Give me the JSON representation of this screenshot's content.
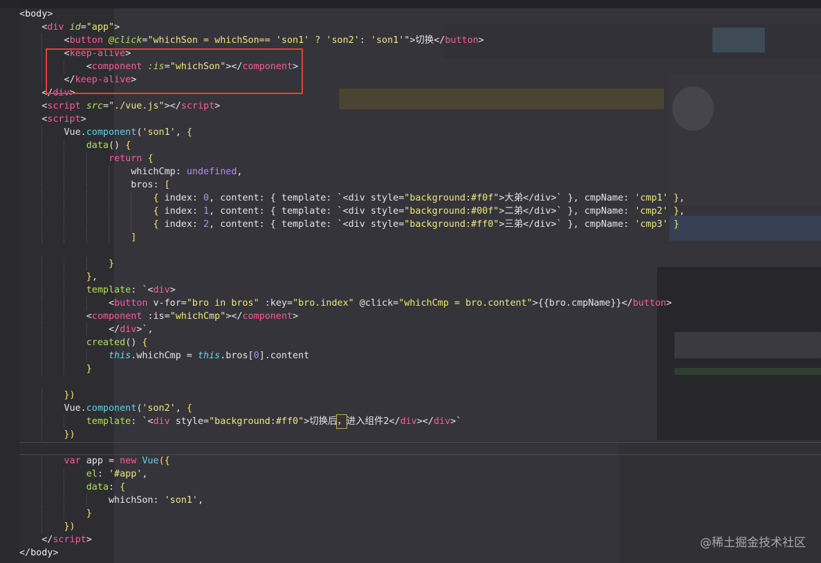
{
  "code_lines": [
    [
      [
        "t-punct",
        "<"
      ],
      [
        "t-tag",
        "body"
      ],
      [
        "t-punct",
        ">"
      ]
    ],
    [
      [
        "t-punct",
        "    <"
      ],
      [
        "t-name",
        "div"
      ],
      [
        "t-punct",
        " "
      ],
      [
        "t-attr-i",
        "id"
      ],
      [
        "t-punct",
        "="
      ],
      [
        "t-str",
        "\"app\""
      ],
      [
        "t-punct",
        ">"
      ]
    ],
    [
      [
        "t-punct",
        "        <"
      ],
      [
        "t-name",
        "button"
      ],
      [
        "t-punct",
        " "
      ],
      [
        "t-attr-i",
        "@click"
      ],
      [
        "t-punct",
        "="
      ],
      [
        "t-str",
        "\"whichSon = whichSon== 'son1' ? 'son2': 'son1'\""
      ],
      [
        "t-punct",
        ">切换</"
      ],
      [
        "t-name",
        "button"
      ],
      [
        "t-punct",
        ">"
      ]
    ],
    [
      [
        "t-punct",
        "        <"
      ],
      [
        "t-name",
        "keep-alive"
      ],
      [
        "t-punct",
        ">"
      ]
    ],
    [
      [
        "t-punct",
        "            <"
      ],
      [
        "t-name",
        "component"
      ],
      [
        "t-punct",
        " "
      ],
      [
        "t-attr-i",
        ":is"
      ],
      [
        "t-punct",
        "="
      ],
      [
        "t-str",
        "\"whichSon\""
      ],
      [
        "t-punct",
        "></"
      ],
      [
        "t-name",
        "component"
      ],
      [
        "t-punct",
        ">"
      ]
    ],
    [
      [
        "t-punct",
        "        </"
      ],
      [
        "t-name",
        "keep-alive"
      ],
      [
        "t-punct",
        ">"
      ]
    ],
    [
      [
        "t-punct",
        "    </"
      ],
      [
        "t-name",
        "div"
      ],
      [
        "t-punct",
        ">"
      ]
    ],
    [
      [
        "t-punct",
        "    <"
      ],
      [
        "t-name",
        "script"
      ],
      [
        "t-punct",
        " "
      ],
      [
        "t-attr-i",
        "src"
      ],
      [
        "t-punct",
        "="
      ],
      [
        "t-str",
        "\"./vue.js\""
      ],
      [
        "t-punct",
        "></"
      ],
      [
        "t-name",
        "script"
      ],
      [
        "t-punct",
        ">"
      ]
    ],
    [
      [
        "t-punct",
        "    <"
      ],
      [
        "t-name",
        "script"
      ],
      [
        "t-punct",
        ">"
      ]
    ],
    [
      [
        "t-punct",
        "        Vue."
      ],
      [
        "t-fn",
        "component"
      ],
      [
        "t-punct",
        "("
      ],
      [
        "t-str",
        "'son1'"
      ],
      [
        "t-punct",
        ", "
      ],
      [
        "t-brace",
        "{"
      ]
    ],
    [
      [
        "t-punct",
        "            "
      ],
      [
        "t-attr",
        "data"
      ],
      [
        "t-punct",
        "() "
      ],
      [
        "t-brace",
        "{"
      ]
    ],
    [
      [
        "t-punct",
        "                "
      ],
      [
        "t-kw",
        "return"
      ],
      [
        "t-punct",
        " "
      ],
      [
        "t-brace",
        "{"
      ]
    ],
    [
      [
        "t-punct",
        "                    whichCmp: "
      ],
      [
        "t-num",
        "undefined"
      ],
      [
        "t-punct",
        ","
      ]
    ],
    [
      [
        "t-punct",
        "                    bros: "
      ],
      [
        "t-brace",
        "["
      ]
    ],
    [
      [
        "t-punct",
        "                        "
      ],
      [
        "t-brace",
        "{"
      ],
      [
        "t-punct",
        " index: "
      ],
      [
        "t-num",
        "0"
      ],
      [
        "t-punct",
        ", content: { template: `<div style="
      ],
      [
        "t-str",
        "\"background:#f0f\""
      ],
      [
        "t-punct",
        ">大弟</div>` }, cmpName: "
      ],
      [
        "t-str",
        "'cmp1'"
      ],
      [
        "t-punct",
        " "
      ],
      [
        "t-brace",
        "}"
      ],
      [
        "t-punct",
        ","
      ]
    ],
    [
      [
        "t-punct",
        "                        "
      ],
      [
        "t-brace",
        "{"
      ],
      [
        "t-punct",
        " index: "
      ],
      [
        "t-num",
        "1"
      ],
      [
        "t-punct",
        ", content: { template: `<div style="
      ],
      [
        "t-str",
        "\"background:#00f\""
      ],
      [
        "t-punct",
        ">二弟</div>` }, cmpName: "
      ],
      [
        "t-str",
        "'cmp2'"
      ],
      [
        "t-punct",
        " "
      ],
      [
        "t-brace",
        "}"
      ],
      [
        "t-punct",
        ","
      ]
    ],
    [
      [
        "t-punct",
        "                        "
      ],
      [
        "t-brace",
        "{"
      ],
      [
        "t-punct",
        " index: "
      ],
      [
        "t-num",
        "2"
      ],
      [
        "t-punct",
        ", content: { template: `<div style="
      ],
      [
        "t-str",
        "\"background:#ff0\""
      ],
      [
        "t-punct",
        ">三弟</div>` }, cmpName: "
      ],
      [
        "t-str",
        "'cmp3'"
      ],
      [
        "t-punct",
        " "
      ],
      [
        "t-brace",
        "}"
      ]
    ],
    [
      [
        "t-punct",
        "                    "
      ],
      [
        "t-brace",
        "]"
      ]
    ],
    [
      [
        "t-punct",
        ""
      ]
    ],
    [
      [
        "t-punct",
        "                "
      ],
      [
        "t-brace",
        "}"
      ]
    ],
    [
      [
        "t-punct",
        "            "
      ],
      [
        "t-brace",
        "}"
      ],
      [
        "t-punct",
        ","
      ]
    ],
    [
      [
        "t-punct",
        "            "
      ],
      [
        "t-attr",
        "template"
      ],
      [
        "t-punct",
        ": `<"
      ],
      [
        "t-name",
        "div"
      ],
      [
        "t-punct",
        ">"
      ]
    ],
    [
      [
        "t-punct",
        "                <"
      ],
      [
        "t-name",
        "button"
      ],
      [
        "t-punct",
        " v-for="
      ],
      [
        "t-str",
        "\"bro in bros\""
      ],
      [
        "t-punct",
        " :key="
      ],
      [
        "t-str",
        "\"bro.index\""
      ],
      [
        "t-punct",
        " @click="
      ],
      [
        "t-str",
        "\"whichCmp = bro.content\""
      ],
      [
        "t-punct",
        ">{{bro.cmpName}}</"
      ],
      [
        "t-name",
        "button"
      ],
      [
        "t-punct",
        ">"
      ]
    ],
    [
      [
        "t-punct",
        "            <"
      ],
      [
        "t-name",
        "component"
      ],
      [
        "t-punct",
        " :is="
      ],
      [
        "t-str",
        "\"whichCmp\""
      ],
      [
        "t-punct",
        "></"
      ],
      [
        "t-name",
        "component"
      ],
      [
        "t-punct",
        ">"
      ]
    ],
    [
      [
        "t-punct",
        "                </"
      ],
      [
        "t-name",
        "div"
      ],
      [
        "t-punct",
        ">`,"
      ]
    ],
    [
      [
        "t-punct",
        "            "
      ],
      [
        "t-attr",
        "created"
      ],
      [
        "t-punct",
        "() "
      ],
      [
        "t-brace",
        "{"
      ]
    ],
    [
      [
        "t-punct",
        "                "
      ],
      [
        "t-this",
        "this"
      ],
      [
        "t-punct",
        ".whichCmp = "
      ],
      [
        "t-this",
        "this"
      ],
      [
        "t-punct",
        ".bros["
      ],
      [
        "t-num",
        "0"
      ],
      [
        "t-punct",
        "].content"
      ]
    ],
    [
      [
        "t-punct",
        "            "
      ],
      [
        "t-brace",
        "}"
      ]
    ],
    [
      [
        "t-punct",
        ""
      ]
    ],
    [
      [
        "t-punct",
        "        "
      ],
      [
        "t-brace",
        "})"
      ]
    ],
    [
      [
        "t-punct",
        "        Vue."
      ],
      [
        "t-fn",
        "component"
      ],
      [
        "t-punct",
        "("
      ],
      [
        "t-str",
        "'son2'"
      ],
      [
        "t-punct",
        ", "
      ],
      [
        "t-brace",
        "{"
      ]
    ],
    [
      [
        "t-punct",
        "            "
      ],
      [
        "t-attr",
        "template"
      ],
      [
        "t-punct",
        ": `<"
      ],
      [
        "t-name",
        "div"
      ],
      [
        "t-punct",
        " style="
      ],
      [
        "t-str",
        "\"background:#ff0\""
      ],
      [
        "t-punct",
        ">切换后"
      ],
      [
        "t-punct",
        "，"
      ],
      [
        "t-punct",
        "进入组件2</"
      ],
      [
        "t-name",
        "div"
      ],
      [
        "t-punct",
        "></"
      ],
      [
        "t-name",
        "div"
      ],
      [
        "t-punct",
        ">`"
      ]
    ],
    [
      [
        "t-punct",
        "        "
      ],
      [
        "t-brace",
        "})"
      ]
    ],
    [
      [
        "t-punct",
        ""
      ]
    ],
    [
      [
        "t-punct",
        "        "
      ],
      [
        "t-kw",
        "var"
      ],
      [
        "t-punct",
        " app = "
      ],
      [
        "t-kw",
        "new"
      ],
      [
        "t-punct",
        " "
      ],
      [
        "t-fn",
        "Vue"
      ],
      [
        "t-brace",
        "({"
      ]
    ],
    [
      [
        "t-punct",
        "            "
      ],
      [
        "t-attr",
        "el"
      ],
      [
        "t-punct",
        ": "
      ],
      [
        "t-str",
        "'#app'"
      ],
      [
        "t-punct",
        ","
      ]
    ],
    [
      [
        "t-punct",
        "            "
      ],
      [
        "t-attr",
        "data"
      ],
      [
        "t-punct",
        ": "
      ],
      [
        "t-brace",
        "{"
      ]
    ],
    [
      [
        "t-punct",
        "                whichSon: "
      ],
      [
        "t-str",
        "'son1'"
      ],
      [
        "t-punct",
        ","
      ]
    ],
    [
      [
        "t-punct",
        "            "
      ],
      [
        "t-brace",
        "}"
      ]
    ],
    [
      [
        "t-punct",
        "        "
      ],
      [
        "t-brace",
        "})"
      ]
    ],
    [
      [
        "t-punct",
        "    </"
      ],
      [
        "t-name",
        "script"
      ],
      [
        "t-punct",
        ">"
      ]
    ],
    [
      [
        "t-punct",
        "</"
      ],
      [
        "t-tag",
        "body"
      ],
      [
        "t-punct",
        ">"
      ]
    ]
  ],
  "watermark": "@稀土掘金技术社区"
}
